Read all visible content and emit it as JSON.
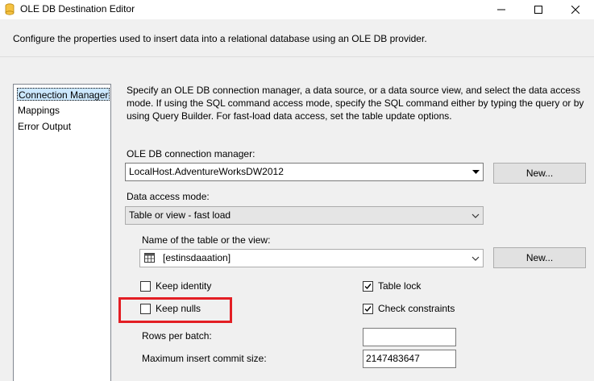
{
  "window": {
    "title": "OLE DB Destination Editor",
    "minimize_glyph": "—",
    "maximize_glyph": "☐",
    "close_glyph": "✕"
  },
  "description": "Configure the properties used to insert data into a relational database using an OLE DB provider.",
  "nav": {
    "items": [
      {
        "label": "Connection Manager",
        "selected": true
      },
      {
        "label": "Mappings",
        "selected": false
      },
      {
        "label": "Error Output",
        "selected": false
      }
    ]
  },
  "instructions": "Specify an OLE DB connection manager, a data source, or a data source view, and select the data access mode. If using the SQL command access mode, specify the SQL command either by typing the query or by using Query Builder. For fast-load data access, set the table update options.",
  "connection": {
    "label": "OLE DB connection manager:",
    "value": "LocalHost.AdventureWorksDW2012",
    "new_button": "New..."
  },
  "access_mode": {
    "label": "Data access mode:",
    "value": "Table or view - fast load"
  },
  "table": {
    "label": "Name of the table or the view:",
    "value": "[estinsdaaation]",
    "new_button": "New..."
  },
  "options": {
    "keep_identity": {
      "label": "Keep identity",
      "checked": false
    },
    "keep_nulls": {
      "label": "Keep nulls",
      "checked": false
    },
    "table_lock": {
      "label": "Table lock",
      "checked": true
    },
    "check_constraints": {
      "label": "Check constraints",
      "checked": true
    }
  },
  "rows_per_batch": {
    "label": "Rows per batch:",
    "value": ""
  },
  "max_commit": {
    "label": "Maximum insert commit size:",
    "value": "2147483647"
  },
  "colors": {
    "highlight": "#e31e24",
    "nav_selected": "#cce8ff"
  }
}
